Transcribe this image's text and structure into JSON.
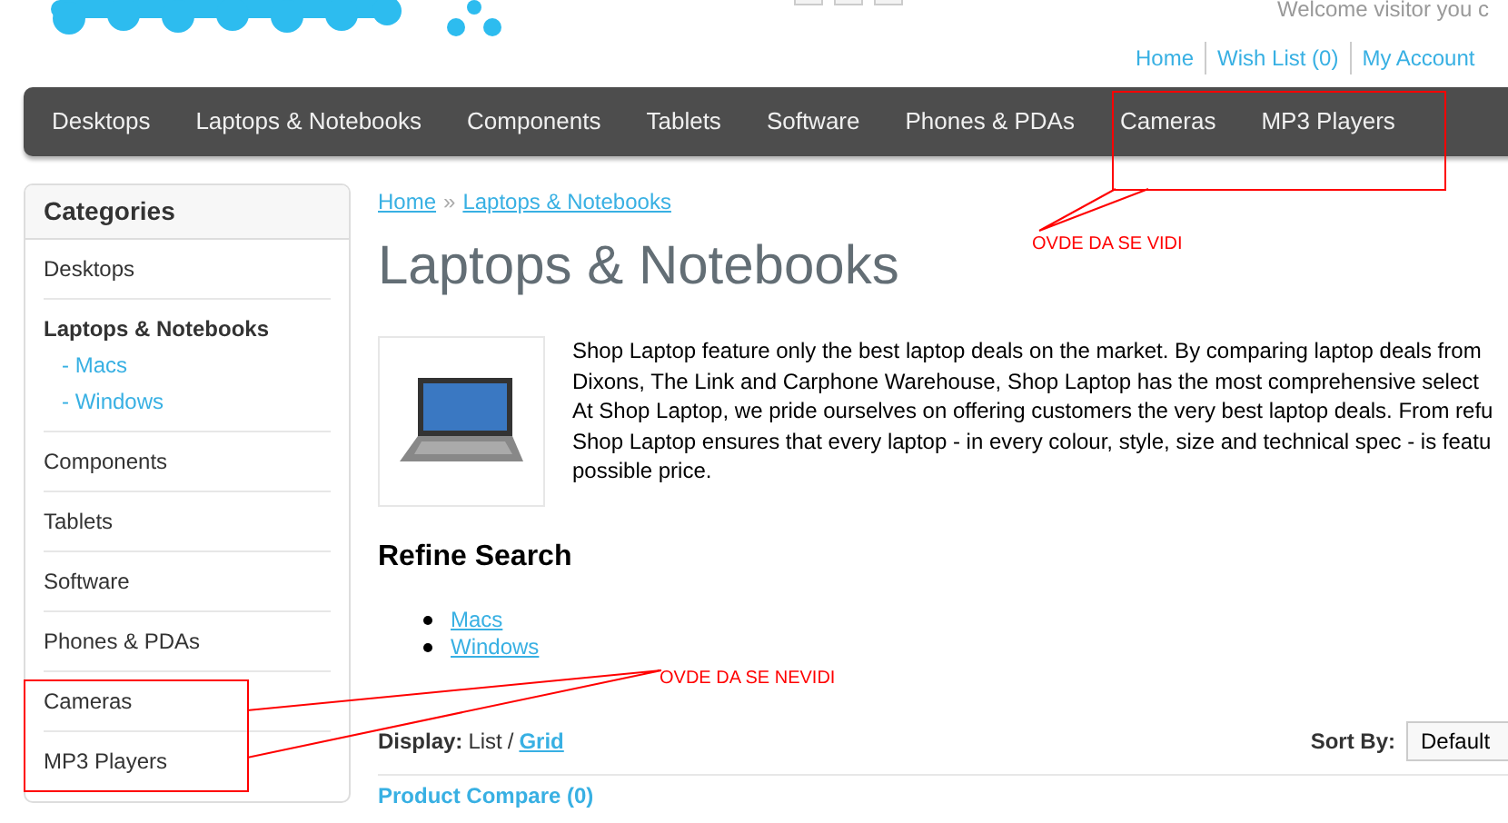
{
  "header": {
    "welcome": "Welcome visitor you c",
    "links": [
      "Home",
      "Wish List (0)",
      "My Account"
    ]
  },
  "nav": {
    "items": [
      "Desktops",
      "Laptops & Notebooks",
      "Components",
      "Tablets",
      "Software",
      "Phones & PDAs",
      "Cameras",
      "MP3 Players"
    ]
  },
  "sidebar": {
    "title": "Categories",
    "items": [
      {
        "label": "Desktops",
        "selected": false
      },
      {
        "label": "Laptops & Notebooks",
        "selected": true,
        "children": [
          {
            "label": "- Macs"
          },
          {
            "label": "- Windows"
          }
        ]
      },
      {
        "label": "Components",
        "selected": false
      },
      {
        "label": "Tablets",
        "selected": false
      },
      {
        "label": "Software",
        "selected": false
      },
      {
        "label": "Phones & PDAs",
        "selected": false
      },
      {
        "label": "Cameras",
        "selected": false
      },
      {
        "label": "MP3 Players",
        "selected": false
      }
    ]
  },
  "breadcrumb": {
    "items": [
      "Home",
      "Laptops & Notebooks"
    ],
    "separator": "»"
  },
  "heading": "Laptops & Notebooks",
  "description": [
    "Shop Laptop feature only the best laptop deals on the market. By comparing laptop deals from",
    "Dixons, The Link and Carphone Warehouse, Shop Laptop has the most comprehensive select",
    "At Shop Laptop, we pride ourselves on offering customers the very best laptop deals. From refu",
    "Shop Laptop ensures that every laptop - in every colour, style, size and technical spec - is featu",
    "possible price."
  ],
  "refine": {
    "title": "Refine Search",
    "links": [
      "Macs",
      "Windows"
    ]
  },
  "display": {
    "label": "Display:",
    "separator": "/",
    "options": [
      {
        "label": "List",
        "selected": true
      },
      {
        "label": "Grid",
        "selected": false
      }
    ]
  },
  "sort": {
    "label": "Sort By:",
    "value": "Default"
  },
  "compare": "Product Compare (0)",
  "annotations": [
    {
      "text": "OVDE DA SE VIDI"
    },
    {
      "text": "OVDE DA SE NEVIDI"
    }
  ]
}
